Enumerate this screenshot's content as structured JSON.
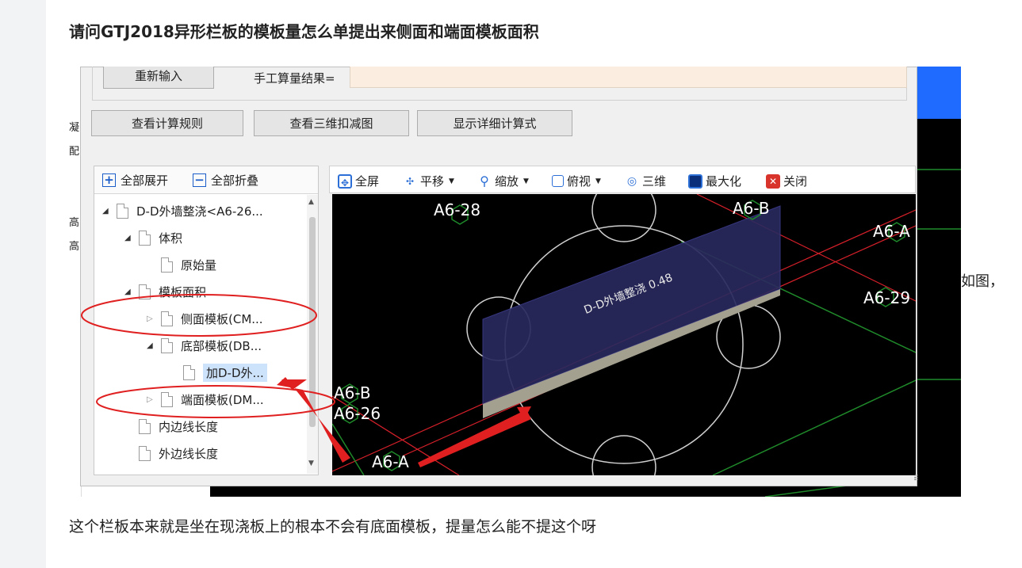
{
  "post": {
    "title": "请问GTJ2018异形栏板的模板量怎么单提出来侧面和端面模板面积",
    "caption_right": "如图，",
    "caption_bottom": "这个栏板本来就是坐在现浇板上的根本不会有底面模板，提量怎么能不提这个呀"
  },
  "background_window": {
    "left_glyphs": [
      "凝",
      "配",
      "高",
      "高"
    ]
  },
  "dialog": {
    "reinput_button": "重新输入",
    "manual_result_label": "手工算量结果=",
    "manual_result_value": "",
    "view_rule_button": "查看计算规则",
    "view_3d_button": "查看三维扣减图",
    "show_detail_button": "显示详细计算式"
  },
  "tree": {
    "expand_all": "全部展开",
    "collapse_all": "全部折叠",
    "nodes": [
      {
        "label": "D-D外墙整浇<A6-26...",
        "level": 0,
        "state": "open"
      },
      {
        "label": "体积",
        "level": 1,
        "state": "open"
      },
      {
        "label": "原始量",
        "level": 2,
        "state": "none"
      },
      {
        "label": "模板面积",
        "level": 1,
        "state": "open"
      },
      {
        "label": "侧面模板(CM...",
        "level": 2,
        "state": "closed"
      },
      {
        "label": "底部模板(DB...",
        "level": 2,
        "state": "open"
      },
      {
        "label": "加D-D外...",
        "level": 3,
        "state": "none",
        "selected": true
      },
      {
        "label": "端面模板(DM...",
        "level": 2,
        "state": "closed"
      },
      {
        "label": "内边线长度",
        "level": 1,
        "state": "none"
      },
      {
        "label": "外边线长度",
        "level": 1,
        "state": "none"
      }
    ]
  },
  "viewer_toolbar": {
    "fullscreen": "全屏",
    "pan": "平移",
    "zoom": "缩放",
    "top_view": "俯视",
    "three_d": "三维",
    "maximize": "最大化",
    "close": "关闭"
  },
  "viewport": {
    "axis_labels": [
      "A6-28",
      "A6-B",
      "A6-A",
      "A6-29",
      "A6-B",
      "A6-26",
      "A6-A"
    ],
    "member_label": "D-D外墙整浇 0.48",
    "colors": {
      "background": "#000000",
      "panel_face": "#2a2a5e",
      "panel_edge": "#a3a08f",
      "axis_red": "#d8202a",
      "axis_green": "#1f8a2a",
      "annotation_red": "#e02020"
    }
  }
}
